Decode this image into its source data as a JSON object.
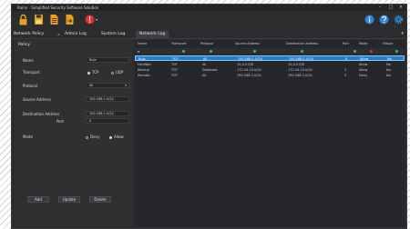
{
  "window": {
    "title": "Rainn - Simplified Security Software Solution",
    "controls": [
      "–",
      "□",
      "×"
    ]
  },
  "toolbar": {
    "left_icons": [
      {
        "name": "lock-icon",
        "color": "#e3a21a"
      },
      {
        "name": "save-icon",
        "color": "#e3a21a"
      },
      {
        "name": "document-icon",
        "color": "#e3a21a"
      },
      {
        "name": "export-icon",
        "color": "#e3a21a"
      },
      {
        "name": "alert-icon",
        "color": "#e0302b"
      }
    ],
    "right_icons": [
      {
        "name": "info-icon",
        "color": "#2f86d6",
        "glyph": "i"
      },
      {
        "name": "help-icon",
        "color": "#2f86d6",
        "glyph": "?"
      },
      {
        "name": "gear-icon",
        "color": "#2f86d6",
        "glyph": "⚙"
      }
    ]
  },
  "tabs": [
    {
      "label": "Network Policy",
      "active": false
    },
    {
      "label": "Admin Log",
      "active": false
    },
    {
      "label": "System Log",
      "active": false
    },
    {
      "label": "Network Log",
      "active": true
    }
  ],
  "tab_close": "×",
  "tab_pin": "▾",
  "policy": {
    "section": "Policy",
    "name_label": "Name",
    "name_value": "Rule",
    "transport_label": "Transport",
    "transport_options": [
      {
        "label": "TCP",
        "selected": true
      },
      {
        "label": "UDP",
        "selected": false
      }
    ],
    "protocol_label": "Protocol",
    "protocol_value": "All",
    "source_label": "Source Address",
    "source_value": "192.168.1.0/24",
    "dest_label": "Destination Address",
    "dest_value": "192.168.1.0/24",
    "port_label": "Port",
    "port_value": "0",
    "mode_label": "Mode",
    "mode_options": [
      {
        "label": "Deny",
        "selected": false
      },
      {
        "label": "Allow",
        "selected": true
      }
    ],
    "buttons": [
      "Add",
      "Update",
      "Delete"
    ]
  },
  "log": {
    "columns": [
      "Name",
      "Transport",
      "Protocol",
      "Source Address",
      "Destination Address",
      "Port",
      "Mode",
      "Hits/yr"
    ],
    "filter_icon": "▾",
    "rows": [
      {
        "cells": [
          "Rule",
          "TCP",
          "All",
          "192.168.1.0/24",
          "192.168.1.0/24",
          "0",
          "Allow",
          "No"
        ],
        "selected": true
      },
      {
        "cells": [
          "DevWeb",
          "TCP",
          "All",
          "10.0.0.0/8",
          "10.0.0.0/8",
          "",
          "Allow",
          "No"
        ],
        "selected": false
      },
      {
        "cells": [
          "Backup",
          "TCP",
          "Database",
          "172.16.10.0/24",
          "172.16.10.0/24",
          "3",
          "Allow",
          "No"
        ],
        "selected": false
      },
      {
        "cells": [
          "Remote",
          "TCP",
          "All",
          "192.168.2.0/24",
          "192.168.2.0/24",
          "3",
          "Deny",
          "No"
        ],
        "selected": false
      }
    ]
  }
}
